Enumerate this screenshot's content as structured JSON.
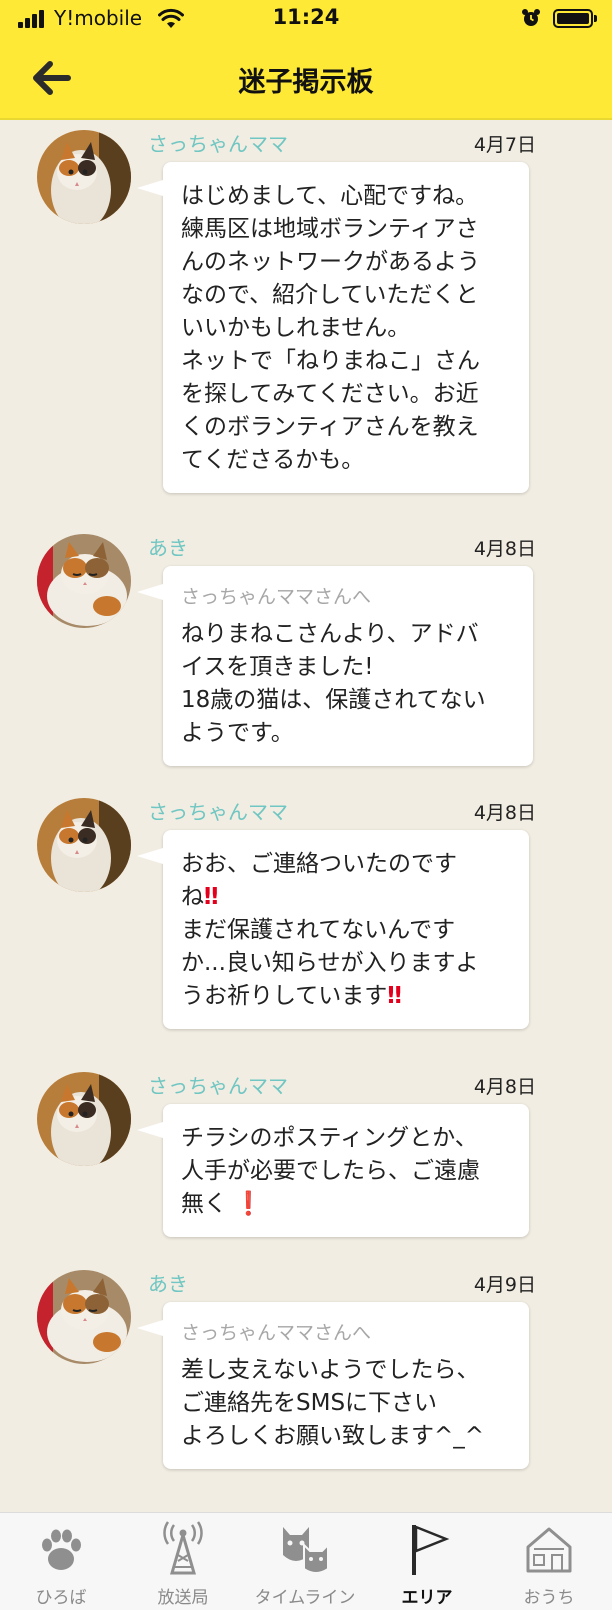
{
  "status_bar": {
    "carrier": "Y!mobile",
    "time": "11:24"
  },
  "header": {
    "title": "迷子掲示板"
  },
  "messages": [
    {
      "author": "さっちゃんママ",
      "date": "4月7日",
      "reply_to": "",
      "text": "はじめまして、心配ですね。\n練馬区は地域ボランティアさ\nんのネットワークがあるよう\nなので、紹介していただくと\nいいかもしれません。\nネットで「ねりまねこ」さん\nを探してみてください。お近\nくのボランティアさんを教え\nてくださるかも。"
    },
    {
      "author": "あき",
      "date": "4月8日",
      "reply_to": "さっちゃんママさんへ",
      "text": "ねりまねこさんより、アドバ\nイスを頂きました!\n18歳の猫は、保護されてない\nようです。"
    },
    {
      "author": "さっちゃんママ",
      "date": "4月8日",
      "reply_to": "",
      "text_parts": [
        "おお、ご連絡ついたのです\nね",
        "‼",
        "\nまだ保護されてないんです\nか...良い知らせが入りますよ\nうお祈りしています",
        "‼"
      ]
    },
    {
      "author": "さっちゃんママ",
      "date": "4月8日",
      "reply_to": "",
      "text_parts": [
        "チラシのポスティングとか、\n人手が必要でしたら、ご遠慮\n無く ",
        "❗"
      ]
    },
    {
      "author": "あき",
      "date": "4月9日",
      "reply_to": "さっちゃんママさんへ",
      "text": "差し支えないようでしたら、\nご連絡先をSMSに下さい\nよろしくお願い致します^_^"
    }
  ],
  "tabs": [
    {
      "label": "ひろば",
      "icon": "paw-icon",
      "active": false
    },
    {
      "label": "放送局",
      "icon": "broadcast-tower-icon",
      "active": false
    },
    {
      "label": "タイムライン",
      "icon": "cats-icon",
      "active": false
    },
    {
      "label": "エリア",
      "icon": "flag-icon",
      "active": true
    },
    {
      "label": "おうち",
      "icon": "house-icon",
      "active": false
    }
  ],
  "colors": {
    "header_bg": "#fde936",
    "page_bg": "#f2ede2",
    "author_name": "#6fc6c2",
    "exclamation": "#e4001c"
  }
}
